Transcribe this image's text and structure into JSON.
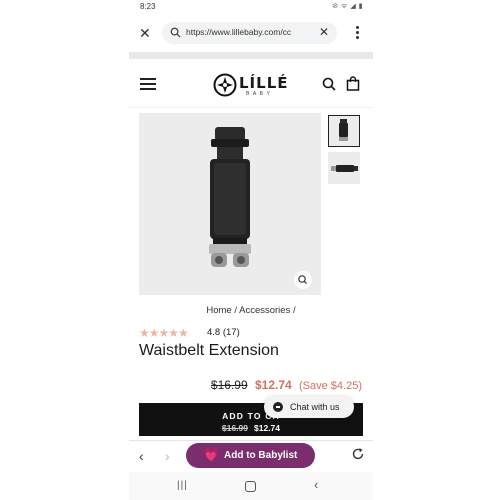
{
  "status_bar": {
    "time": "8:23",
    "icons": "⊘ ᯤ ◢ ▮"
  },
  "browser": {
    "url": "https://www.lillebaby.com/cc",
    "close_glyph": "✕",
    "clear_glyph": "✕",
    "back_glyph": "‹",
    "forward_glyph": "›"
  },
  "site": {
    "logo_word": "LÍLLÉ",
    "logo_sub": "BABY"
  },
  "breadcrumb": "Home / Accessories /",
  "product": {
    "rating_stars": "★★★★★",
    "rating_value": 4.8,
    "rating_text": "4.8 (17)",
    "title": "Waistbelt Extension",
    "price_old": "$16.99",
    "price_new": "$12.74",
    "price_save": "(Save $4.25)"
  },
  "add_to_cart": {
    "label": "ADD TO CA",
    "price_old": "$16.99",
    "price_new": "$12.74"
  },
  "chat": {
    "label": "Chat with us"
  },
  "babylist": {
    "heart": "💗",
    "label": "Add to Babylist"
  },
  "android_nav": {
    "recents": "|||",
    "back": "‹"
  },
  "colors": {
    "sale": "#d2705e",
    "babylist": "#7a2e6e",
    "stars": "#e9b8a3",
    "button": "#111111"
  }
}
